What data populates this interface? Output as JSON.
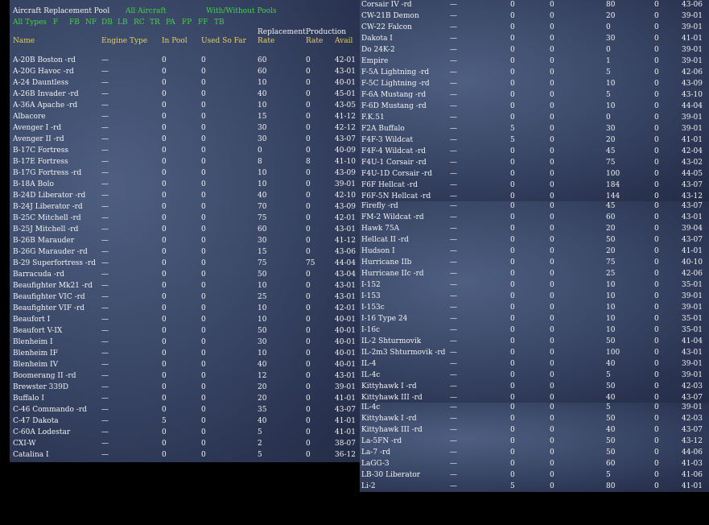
{
  "header": {
    "title": "Aircraft Replacement Pool",
    "all_aircraft": "All Aircraft",
    "with_without": "With/Without Pools",
    "filters": [
      "All Types",
      "F",
      "FB",
      "NF",
      "DB",
      "LB",
      "RC",
      "TR",
      "PA",
      "FP",
      "FF",
      "TB"
    ]
  },
  "columns_left": {
    "name": "Name",
    "engine": "Engine Type",
    "pool": "In Pool",
    "used": "Used So Far",
    "rep_top": "Replacement",
    "rep": "Rate",
    "prod_top": "Production",
    "prod": "Rate",
    "avail": "Avail"
  },
  "left_rows": [
    [
      "A-20B Boston -rd",
      "—",
      "0",
      "0",
      "60",
      "0",
      "42-01"
    ],
    [
      "A-20G Havoc -rd",
      "—",
      "0",
      "0",
      "60",
      "0",
      "43-01"
    ],
    [
      "A-24 Dauntless",
      "—",
      "0",
      "0",
      "10",
      "0",
      "40-01"
    ],
    [
      "A-26B Invader -rd",
      "—",
      "0",
      "0",
      "40",
      "0",
      "45-01"
    ],
    [
      "A-36A Apache -rd",
      "—",
      "0",
      "0",
      "10",
      "0",
      "43-05"
    ],
    [
      "Albacore",
      "—",
      "0",
      "0",
      "15",
      "0",
      "41-12"
    ],
    [
      "Avenger I -rd",
      "—",
      "0",
      "0",
      "30",
      "0",
      "42-12"
    ],
    [
      "Avenger II -rd",
      "—",
      "0",
      "0",
      "30",
      "0",
      "43-07"
    ],
    [
      "B-17C Fortress",
      "—",
      "0",
      "0",
      "0",
      "0",
      "40-09"
    ],
    [
      "B-17E Fortress",
      "—",
      "0",
      "0",
      "8",
      "8",
      "41-10"
    ],
    [
      "B-17G Fortress -rd",
      "—",
      "0",
      "0",
      "10",
      "0",
      "43-09"
    ],
    [
      "B-18A Bolo",
      "—",
      "0",
      "0",
      "10",
      "0",
      "39-01"
    ],
    [
      "B-24D Liberator -rd",
      "—",
      "0",
      "0",
      "40",
      "0",
      "42-10"
    ],
    [
      "B-24J Liberator -rd",
      "—",
      "0",
      "0",
      "70",
      "0",
      "43-09"
    ],
    [
      "B-25C Mitchell -rd",
      "—",
      "0",
      "0",
      "75",
      "0",
      "42-01"
    ],
    [
      "B-25J Mitchell -rd",
      "—",
      "0",
      "0",
      "60",
      "0",
      "43-01"
    ],
    [
      "B-26B Marauder",
      "—",
      "0",
      "0",
      "30",
      "0",
      "41-12"
    ],
    [
      "B-26G Marauder -rd",
      "—",
      "0",
      "0",
      "15",
      "0",
      "43-06"
    ],
    [
      "B-29 Superfortress -rd",
      "—",
      "0",
      "0",
      "75",
      "75",
      "44-04"
    ],
    [
      "Barracuda -rd",
      "—",
      "0",
      "0",
      "50",
      "0",
      "43-04"
    ],
    [
      "Beaufighter Mk21 -rd",
      "—",
      "0",
      "0",
      "10",
      "0",
      "43-01"
    ],
    [
      "Beaufighter VIC -rd",
      "—",
      "0",
      "0",
      "25",
      "0",
      "43-01"
    ],
    [
      "Beaufighter VIF -rd",
      "—",
      "0",
      "0",
      "10",
      "0",
      "42-01"
    ],
    [
      "Beaufort I",
      "—",
      "0",
      "0",
      "10",
      "0",
      "40-01"
    ],
    [
      "Beaufort V-IX",
      "—",
      "0",
      "0",
      "50",
      "0",
      "40-01"
    ],
    [
      "Blenheim I",
      "—",
      "0",
      "0",
      "30",
      "0",
      "40-01"
    ],
    [
      "Blenheim IF",
      "—",
      "0",
      "0",
      "10",
      "0",
      "40-01"
    ],
    [
      "Blenheim IV",
      "—",
      "0",
      "0",
      "40",
      "0",
      "40-01"
    ],
    [
      "Boomerang II -rd",
      "—",
      "0",
      "0",
      "12",
      "0",
      "43-01"
    ],
    [
      "Brewster 339D",
      "—",
      "0",
      "0",
      "20",
      "0",
      "39-01"
    ],
    [
      "Buffalo I",
      "—",
      "0",
      "0",
      "20",
      "0",
      "41-01"
    ],
    [
      "C-46 Commando -rd",
      "—",
      "0",
      "0",
      "35",
      "0",
      "43-07"
    ],
    [
      "C-47 Dakota",
      "—",
      "5",
      "0",
      "40",
      "0",
      "41-01"
    ],
    [
      "C-60A Lodestar",
      "—",
      "0",
      "0",
      "5",
      "0",
      "41-01"
    ],
    [
      "CXI-W",
      "—",
      "0",
      "0",
      "2",
      "0",
      "38-07"
    ],
    [
      "Catalina I",
      "—",
      "0",
      "0",
      "5",
      "0",
      "36-12"
    ]
  ],
  "right_rows_top": [
    [
      "Corsair IV -rd",
      "—",
      "0",
      "0",
      "80",
      "0",
      "43-06"
    ],
    [
      "CW-21B Demon",
      "—",
      "0",
      "0",
      "20",
      "0",
      "39-01"
    ],
    [
      "CW-22 Falcon",
      "—",
      "0",
      "0",
      "0",
      "0",
      "39-01"
    ],
    [
      "Dakota I",
      "—",
      "0",
      "0",
      "30",
      "0",
      "41-01"
    ],
    [
      "Do 24K-2",
      "—",
      "0",
      "0",
      "0",
      "0",
      "39-01"
    ],
    [
      "Empire",
      "—",
      "0",
      "0",
      "1",
      "0",
      "39-01"
    ],
    [
      "F-5A Lightning -rd",
      "—",
      "0",
      "0",
      "5",
      "0",
      "42-06"
    ],
    [
      "F-5C Lightning -rd",
      "—",
      "0",
      "0",
      "10",
      "0",
      "43-09"
    ],
    [
      "F-6A Mustang -rd",
      "—",
      "0",
      "0",
      "5",
      "0",
      "43-10"
    ],
    [
      "F-6D Mustang -rd",
      "—",
      "0",
      "0",
      "10",
      "0",
      "44-04"
    ],
    [
      "F.K.51",
      "—",
      "0",
      "0",
      "0",
      "0",
      "39-01"
    ],
    [
      "F2A Buffalo",
      "—",
      "5",
      "0",
      "30",
      "0",
      "39-01"
    ],
    [
      "F4F-3 Wildcat",
      "—",
      "5",
      "0",
      "20",
      "0",
      "41-01"
    ],
    [
      "F4F-4 Wildcat -rd",
      "—",
      "0",
      "0",
      "45",
      "0",
      "42-04"
    ],
    [
      "F4U-1 Corsair -rd",
      "—",
      "0",
      "0",
      "75",
      "0",
      "43-02"
    ],
    [
      "F4U-1D Corsair -rd",
      "—",
      "0",
      "0",
      "100",
      "0",
      "44-05"
    ],
    [
      "F6F Hellcat -rd",
      "—",
      "0",
      "0",
      "184",
      "0",
      "43-07"
    ],
    [
      "F6F-5N Hellcat -rd",
      "—",
      "0",
      "0",
      "144",
      "0",
      "43-12"
    ]
  ],
  "right_rows_mid": [
    [
      "Firefly -rd",
      "—",
      "0",
      "0",
      "45",
      "0",
      "43-07"
    ],
    [
      "FM-2 Wildcat -rd",
      "—",
      "0",
      "0",
      "60",
      "0",
      "43-01"
    ],
    [
      "Hawk 75A",
      "—",
      "0",
      "0",
      "20",
      "0",
      "39-04"
    ],
    [
      "Hellcat II -rd",
      "—",
      "0",
      "0",
      "50",
      "0",
      "43-07"
    ],
    [
      "Hudson I",
      "—",
      "0",
      "0",
      "20",
      "0",
      "41-01"
    ],
    [
      "Hurricane IIb",
      "—",
      "0",
      "0",
      "75",
      "0",
      "40-10"
    ],
    [
      "Hurricane IIc -rd",
      "—",
      "0",
      "0",
      "25",
      "0",
      "42-06"
    ],
    [
      "I-152",
      "—",
      "0",
      "0",
      "10",
      "0",
      "35-01"
    ],
    [
      "I-153",
      "—",
      "0",
      "0",
      "10",
      "0",
      "39-01"
    ],
    [
      "I-153c",
      "—",
      "0",
      "0",
      "10",
      "0",
      "39-01"
    ],
    [
      "I-16 Type 24",
      "—",
      "0",
      "0",
      "10",
      "0",
      "35-01"
    ],
    [
      "I-16c",
      "—",
      "0",
      "0",
      "10",
      "0",
      "35-01"
    ],
    [
      "IL-2 Shturmovik",
      "—",
      "0",
      "0",
      "50",
      "0",
      "41-04"
    ],
    [
      "IL-2m3 Shturmovik -rd",
      "—",
      "0",
      "0",
      "100",
      "0",
      "43-01"
    ],
    [
      "IL-4",
      "—",
      "0",
      "0",
      "40",
      "0",
      "39-01"
    ],
    [
      "IL-4c",
      "—",
      "0",
      "0",
      "5",
      "0",
      "39-01"
    ],
    [
      "Kittyhawk I -rd",
      "—",
      "0",
      "0",
      "50",
      "0",
      "42-03"
    ],
    [
      "Kittyhawk III -rd",
      "—",
      "0",
      "0",
      "40",
      "0",
      "43-07"
    ]
  ],
  "right_rows_bottom": [
    [
      "IL-4c",
      "—",
      "0",
      "0",
      "5",
      "0",
      "39-01"
    ],
    [
      "Kittyhawk I -rd",
      "—",
      "0",
      "0",
      "50",
      "0",
      "42-03"
    ],
    [
      "Kittyhawk III -rd",
      "—",
      "0",
      "0",
      "40",
      "0",
      "43-07"
    ],
    [
      "La-5FN -rd",
      "—",
      "0",
      "0",
      "50",
      "0",
      "43-12"
    ],
    [
      "La-7 -rd",
      "—",
      "0",
      "0",
      "50",
      "0",
      "44-06"
    ],
    [
      "LaGG-3",
      "—",
      "0",
      "0",
      "60",
      "0",
      "41-03"
    ],
    [
      "LB-30 Liberator",
      "—",
      "0",
      "0",
      "5",
      "0",
      "41-06"
    ],
    [
      "Li-2",
      "—",
      "5",
      "0",
      "80",
      "0",
      "41-01"
    ]
  ]
}
